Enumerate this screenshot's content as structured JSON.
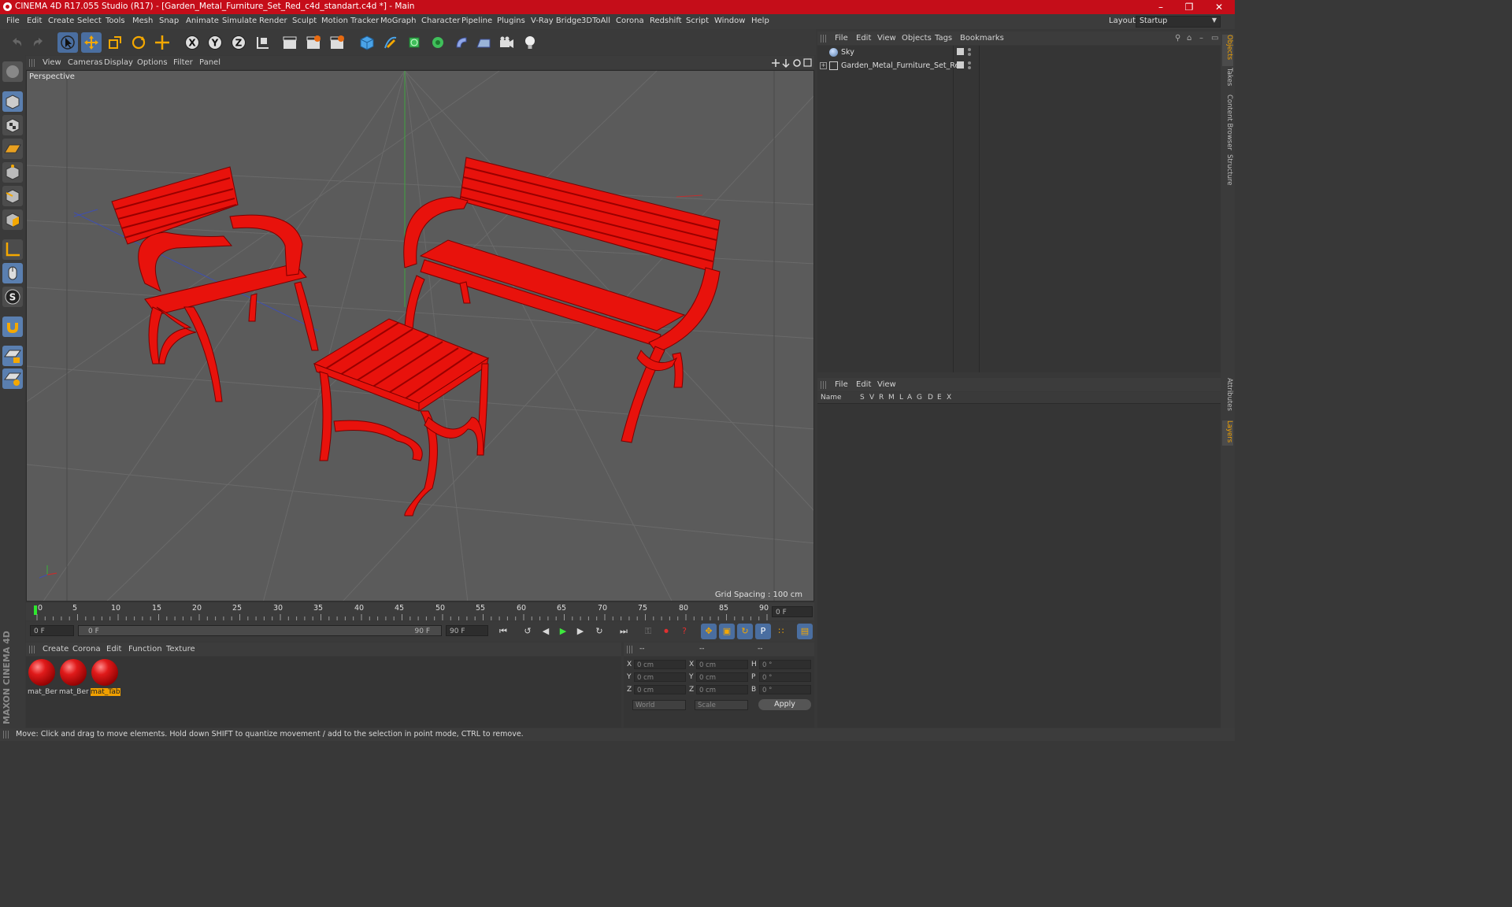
{
  "app": {
    "window_title": "CINEMA 4D R17.055 Studio (R17) - [Garden_Metal_Furniture_Set_Red_c4d_standart.c4d *] - Main",
    "layout_label": "Layout:",
    "layout_value": "Startup"
  },
  "menubar": [
    "File",
    "Edit",
    "Create",
    "Select",
    "Tools",
    "Mesh",
    "Snap",
    "Animate",
    "Simulate",
    "Render",
    "Sculpt",
    "Motion Tracker",
    "MoGraph",
    "Character",
    "Pipeline",
    "Plugins",
    "V-Ray Bridge",
    "3DToAll",
    "Corona",
    "Redshift",
    "Script",
    "Window",
    "Help"
  ],
  "viewport": {
    "menu": [
      "View",
      "Cameras",
      "Display",
      "Options",
      "Filter",
      "Panel"
    ],
    "label": "Perspective",
    "grid_spacing": "Grid Spacing : 100 cm"
  },
  "timeline": {
    "ticks": [
      "0",
      "5",
      "10",
      "15",
      "20",
      "25",
      "30",
      "35",
      "40",
      "45",
      "50",
      "55",
      "60",
      "65",
      "70",
      "75",
      "80",
      "85",
      "90"
    ],
    "current_frame": "0 F",
    "start_field": "0 F",
    "range_start": "0 F",
    "range_end": "90 F",
    "end_field": "90 F"
  },
  "material_manager": {
    "menu": [
      "Create",
      "Corona",
      "Edit",
      "Function",
      "Texture"
    ],
    "materials": [
      {
        "name": "mat_Ber",
        "selected": false
      },
      {
        "name": "mat_Ber",
        "selected": false
      },
      {
        "name": "mat_Tab",
        "selected": true
      }
    ]
  },
  "coordinates": {
    "header": [
      "--",
      "--",
      "--"
    ],
    "rows": [
      {
        "axis": "X",
        "pos": "0 cm",
        "axis2": "X",
        "size": "0 cm",
        "rot_label": "H",
        "rot": "0 °"
      },
      {
        "axis": "Y",
        "pos": "0 cm",
        "axis2": "Y",
        "size": "0 cm",
        "rot_label": "P",
        "rot": "0 °"
      },
      {
        "axis": "Z",
        "pos": "0 cm",
        "axis2": "Z",
        "size": "0 cm",
        "rot_label": "B",
        "rot": "0 °"
      }
    ],
    "mode_world": "World",
    "mode_scale": "Scale",
    "apply": "Apply"
  },
  "object_manager": {
    "menu": [
      "File",
      "Edit",
      "View",
      "Objects",
      "Tags",
      "Bookmarks"
    ],
    "objects": [
      {
        "name": "Sky"
      },
      {
        "name": "Garden_Metal_Furniture_Set_Red"
      }
    ]
  },
  "layer_manager": {
    "menu": [
      "File",
      "Edit",
      "View"
    ],
    "columns": [
      "Name",
      "S",
      "V",
      "R",
      "M",
      "L",
      "A",
      "G",
      "D",
      "E",
      "X"
    ]
  },
  "side_tabs": [
    "Objects",
    "Takes",
    "Content Browser",
    "Structure",
    "Attributes",
    "Layers"
  ],
  "status": "Move: Click and drag to move elements. Hold down SHIFT to quantize movement / add to the selection in point mode, CTRL to remove.",
  "brand": "MAXON CINEMA 4D",
  "colors": {
    "title_bar": "#c50d19",
    "accent": "#f0a000",
    "furniture": "#e8120c"
  }
}
